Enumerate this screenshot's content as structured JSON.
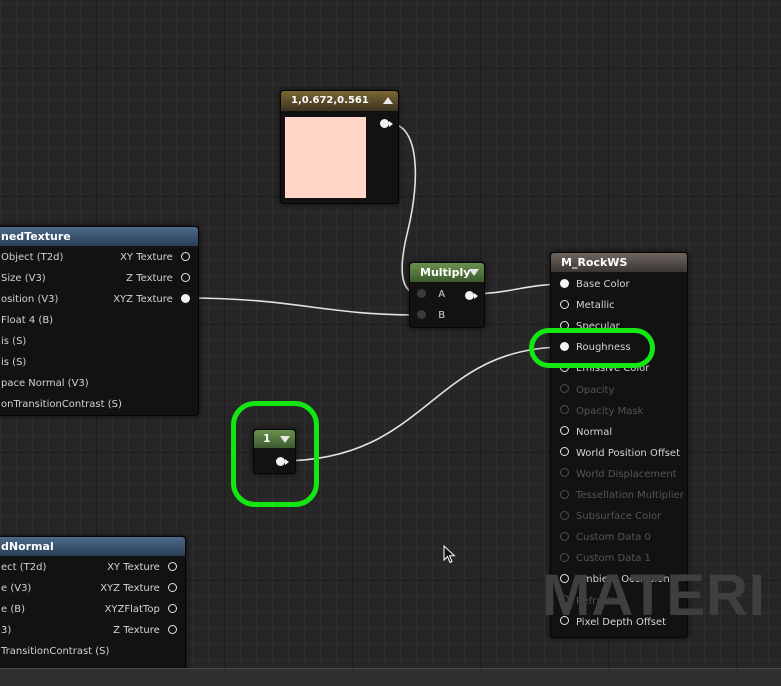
{
  "watermark": "MATERI",
  "colors": {
    "highlight": "#14e614",
    "constant_swatch": "#ffd6c8",
    "constant_header": "#6b5a2c",
    "multiply_header": "#51703c",
    "scalar_header": "#51703c",
    "result_header": "#59534d",
    "texture_header": "#3f5873"
  },
  "constant3_node": {
    "title": "1,0.672,0.561",
    "swatch_color": "#ffd6c8",
    "collapse_icon": "triangle-up-icon"
  },
  "multiply_node": {
    "title": "Multiply",
    "inputs": [
      "A",
      "B"
    ],
    "collapse_icon": "triangle-down-icon"
  },
  "scalar_node": {
    "title": "1",
    "collapse_icon": "triangle-down-icon"
  },
  "material_node": {
    "title": "M_RockWS",
    "pins": [
      {
        "label": "Base Color",
        "enabled": true,
        "connected": true
      },
      {
        "label": "Metallic",
        "enabled": true,
        "connected": false
      },
      {
        "label": "Specular",
        "enabled": true,
        "connected": false
      },
      {
        "label": "Roughness",
        "enabled": true,
        "connected": true
      },
      {
        "label": "Emissive Color",
        "enabled": true,
        "connected": false
      },
      {
        "label": "Opacity",
        "enabled": false,
        "connected": false
      },
      {
        "label": "Opacity Mask",
        "enabled": false,
        "connected": false
      },
      {
        "label": "Normal",
        "enabled": true,
        "connected": false
      },
      {
        "label": "World Position Offset",
        "enabled": true,
        "connected": false
      },
      {
        "label": "World Displacement",
        "enabled": false,
        "connected": false
      },
      {
        "label": "Tessellation Multiplier",
        "enabled": false,
        "connected": false
      },
      {
        "label": "Subsurface Color",
        "enabled": false,
        "connected": false
      },
      {
        "label": "Custom Data 0",
        "enabled": false,
        "connected": false
      },
      {
        "label": "Custom Data 1",
        "enabled": false,
        "connected": false
      },
      {
        "label": "Ambient Occlusion",
        "enabled": true,
        "connected": false
      },
      {
        "label": "Refraction",
        "enabled": false,
        "connected": false
      },
      {
        "label": "Pixel Depth Offset",
        "enabled": true,
        "connected": false
      }
    ]
  },
  "world_aligned_texture_node": {
    "title": "nedTexture",
    "inputs": [
      "Object (T2d)",
      "Size (V3)",
      "osition (V3)",
      "Float 4 (B)",
      "is (S)",
      "is (S)",
      "pace Normal (V3)",
      "onTransitionContrast (S)"
    ],
    "outputs": [
      {
        "label": "XY Texture",
        "connected": false
      },
      {
        "label": "Z Texture",
        "connected": false
      },
      {
        "label": "XYZ Texture",
        "connected": true
      }
    ]
  },
  "world_aligned_normal_node": {
    "title": "dNormal",
    "inputs": [
      "ect (T2d)",
      "e (V3)",
      "e (B)",
      "3)",
      "TransitionContrast (S)"
    ],
    "outputs": [
      {
        "label": "XY Texture",
        "connected": false
      },
      {
        "label": "XYZ Texture",
        "connected": false
      },
      {
        "label": "XYZFlatTop",
        "connected": false
      },
      {
        "label": "Z Texture",
        "connected": false
      }
    ]
  }
}
